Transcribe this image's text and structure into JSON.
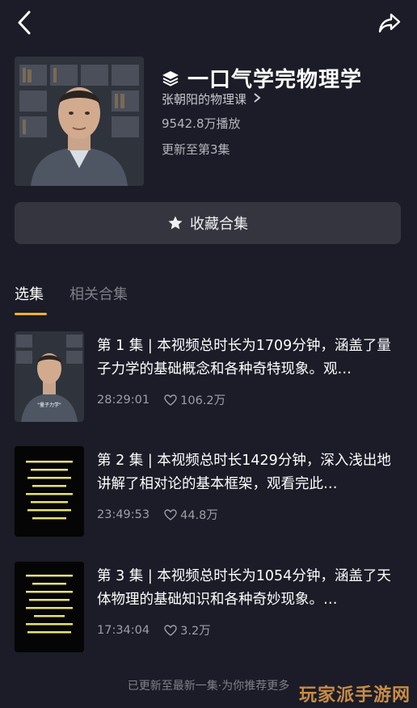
{
  "collection": {
    "title": "一口气学完物理学",
    "author": "张朝阳的物理课",
    "plays": "9542.8万播放",
    "updated": "更新至第3集"
  },
  "collect_button": {
    "label": "收藏合集"
  },
  "tabs": [
    {
      "label": "选集"
    },
    {
      "label": "相关合集"
    }
  ],
  "episodes": [
    {
      "title": "第 1 集 | 本视频总时长为1709分钟，涵盖了量子力学的基础概念和各种奇特现象。观…",
      "duration": "28:29:01",
      "likes": "106.2万",
      "thumb_caption": "\"量子力学\""
    },
    {
      "title": "第 2 集 | 本视频总时长1429分钟，深入浅出地讲解了相对论的基本框架，观看完此…",
      "duration": "23:49:53",
      "likes": "44.8万"
    },
    {
      "title": "第 3 集 | 本视频总时长为1054分钟，涵盖了天体物理的基础知识和各种奇妙现象。…",
      "duration": "17:34:04",
      "likes": "3.2万"
    }
  ],
  "footer": "已更新至最新一集·为你推荐更多",
  "watermark": "玩家派手游网",
  "colors": {
    "background": "#1b1c27",
    "tab_indicator": "#f5b02a",
    "button_bg": "#34353f"
  },
  "icons": [
    "back-icon",
    "share-icon",
    "stack-icon",
    "chevron-right-icon",
    "star-icon",
    "heart-icon"
  ]
}
